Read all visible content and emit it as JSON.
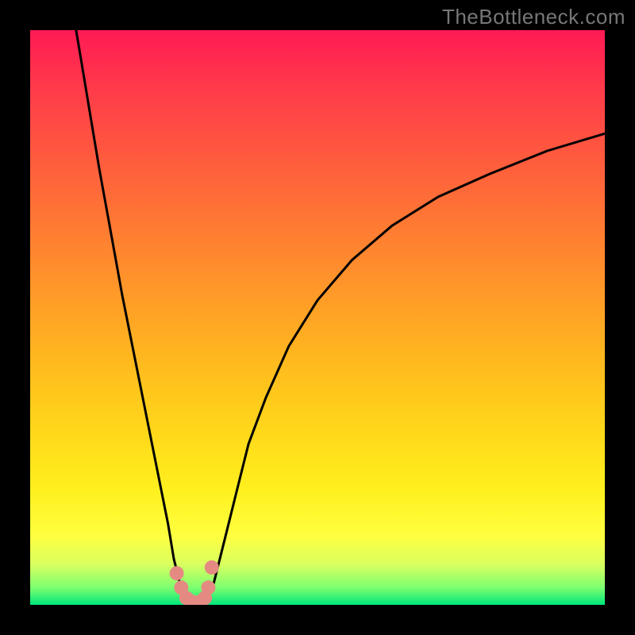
{
  "watermark": "TheBottleneck.com",
  "chart_data": {
    "type": "line",
    "title": "",
    "xlabel": "",
    "ylabel": "",
    "xlim": [
      0,
      100
    ],
    "ylim": [
      0,
      100
    ],
    "grid": false,
    "series": [
      {
        "name": "curve-left",
        "color": "#000000",
        "x": [
          8,
          10,
          12,
          14,
          16,
          18,
          20,
          22,
          24,
          25,
          26,
          27
        ],
        "y": [
          100,
          88,
          76,
          65,
          54,
          44,
          34,
          24,
          14,
          8,
          4,
          1
        ]
      },
      {
        "name": "curve-right",
        "color": "#000000",
        "x": [
          31,
          32,
          34,
          36,
          38,
          41,
          45,
          50,
          56,
          63,
          71,
          80,
          90,
          100
        ],
        "y": [
          1,
          4,
          12,
          20,
          28,
          36,
          45,
          53,
          60,
          66,
          71,
          75,
          79,
          82
        ]
      },
      {
        "name": "valley-floor",
        "color": "#000000",
        "x": [
          27,
          28,
          29,
          30,
          31
        ],
        "y": [
          1,
          0,
          0,
          0,
          1
        ]
      },
      {
        "name": "valley-marker-dots",
        "color": "#e58a82",
        "type": "scatter",
        "x": [
          25.5,
          26.3,
          27.2,
          28.3,
          29.5,
          30.4,
          31.0,
          31.6
        ],
        "y": [
          5.5,
          3.0,
          1.2,
          0.5,
          0.5,
          1.2,
          3.0,
          6.5
        ]
      }
    ]
  }
}
